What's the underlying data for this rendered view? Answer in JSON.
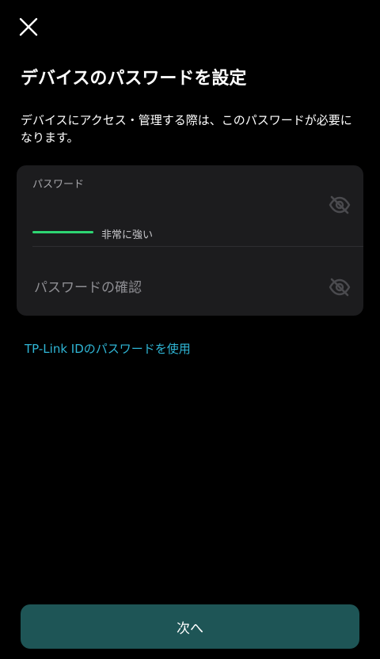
{
  "header": {
    "close_icon": "close-icon"
  },
  "title": "デバイスのパスワードを設定",
  "description": "デバイスにアクセス・管理する際は、このパスワードが必要になります。",
  "form": {
    "password": {
      "label": "パスワード",
      "value": "",
      "visibility_icon": "eye-off-icon",
      "strength": {
        "label": "非常に強い",
        "level": 1.0,
        "color": "#2ed573"
      }
    },
    "confirm": {
      "placeholder": "パスワードの確認",
      "value": "",
      "visibility_icon": "eye-off-icon"
    }
  },
  "link": {
    "label": "TP-Link IDのパスワードを使用",
    "color": "#2fb6d6"
  },
  "next_button": {
    "label": "次へ",
    "color": "#1e5556"
  }
}
